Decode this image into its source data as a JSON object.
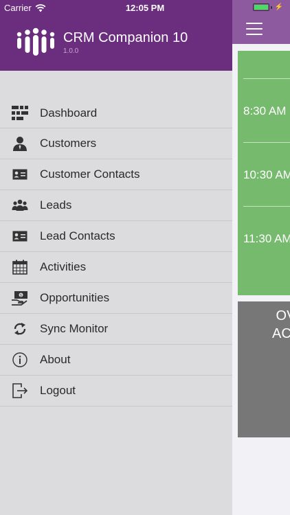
{
  "status_bar": {
    "carrier": "Carrier",
    "time": "12:05 PM",
    "battery_level": 1.0
  },
  "drawer": {
    "app_title": "CRM Companion 10",
    "app_version": "1.0.0",
    "menu": [
      {
        "label": "Dashboard",
        "icon": "dashboard-icon"
      },
      {
        "label": "Customers",
        "icon": "person-icon"
      },
      {
        "label": "Customer Contacts",
        "icon": "contact-card-icon"
      },
      {
        "label": "Leads",
        "icon": "group-icon"
      },
      {
        "label": "Lead Contacts",
        "icon": "contact-card-icon"
      },
      {
        "label": "Activities",
        "icon": "calendar-icon"
      },
      {
        "label": "Opportunities",
        "icon": "money-hand-icon"
      },
      {
        "label": "Sync Monitor",
        "icon": "sync-icon"
      },
      {
        "label": "About",
        "icon": "info-icon"
      },
      {
        "label": "Logout",
        "icon": "logout-icon"
      }
    ]
  },
  "main": {
    "schedule_times": [
      "8:30 AM",
      "10:30 AM",
      "11:30 AM"
    ],
    "overdue_card_text": [
      "OV",
      "ACT"
    ]
  },
  "colors": {
    "header_purple": "#6b2d7d",
    "main_header_purple": "#8d5aa0",
    "drawer_bg": "#dcdbdd",
    "schedule_green": "#76ba6e",
    "overdue_gray": "#777777"
  }
}
